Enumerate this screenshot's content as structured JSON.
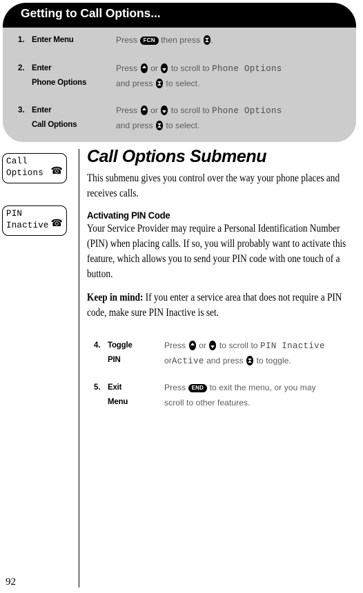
{
  "page": {
    "number": "92"
  },
  "callout": {
    "title": "Getting to Call Options...",
    "steps": [
      {
        "num": "1.",
        "label_line1": "Enter Menu",
        "label_line2": "",
        "instr_line1_pre": "Press",
        "instr_line1_badge": "FCN",
        "instr_line1_mid": "then press",
        "instr_line1_post": ".",
        "instr_line2": ""
      },
      {
        "num": "2.",
        "label_line1": "Enter",
        "label_line2": "Phone Options",
        "instr_line1_pre": "Press",
        "instr_line1_mid": "or",
        "instr_line1_post": "to scroll to",
        "instr_line1_lcd": "Phone Options",
        "instr_line2_pre": "and press",
        "instr_line2_post": "to select."
      },
      {
        "num": "3.",
        "label_line1": "Enter",
        "label_line2": "Call Options",
        "instr_line1_pre": "Press",
        "instr_line1_mid": "or",
        "instr_line1_post": "to scroll to",
        "instr_line1_lcd": "Phone Options",
        "instr_line2_pre": "and press",
        "instr_line2_post": "to select."
      }
    ]
  },
  "lcd_chips": [
    {
      "name": "call-options-display",
      "line1": "Call",
      "line2": "Options",
      "glyph": "telephone-icon"
    },
    {
      "name": "pin-inactive-display",
      "line1": "PIN",
      "line2": "Inactive",
      "glyph": "telephone-icon"
    }
  ],
  "article": {
    "title": "Call Options Submenu",
    "intro": "This submenu gives you control over the way your phone places and receives calls.",
    "subheading": "Activating PIN Code",
    "paragraph": "Your Service Provider may require a Personal Identification Number (PIN) when placing calls. If so, you will probably want to activate this feature, which allows you to send your PIN code with one touch of a button.",
    "keep_in_mind_label": "Keep in mind:",
    "keep_in_mind_text": " If you enter a service area that does not require a PIN code, make sure PIN Inactive is set.",
    "steps": [
      {
        "num": "4.",
        "label_line1": "Toggle",
        "label_line2": "PIN",
        "instr_line1_pre": "Press",
        "instr_line1_mid": "or",
        "instr_line1_post": "to scroll to",
        "instr_line1_lcd": "PIN Inactive",
        "instr_line2_pre": "or",
        "instr_line2_lcd": "Active",
        "instr_line2_mid": "and press",
        "instr_line2_post": "to toggle."
      },
      {
        "num": "5.",
        "label_line1": "Exit",
        "label_line2": "Menu",
        "instr_line1_pre": "Press",
        "instr_line1_badge": "END",
        "instr_line1_post": "to exit the menu, or you may",
        "instr_line2": "scroll to other features."
      }
    ]
  },
  "colors": {
    "header_bar": "#000000",
    "callout_body": "#cccccc",
    "instruction_text": "#5a5a5a",
    "page_background": "#ffffff"
  }
}
